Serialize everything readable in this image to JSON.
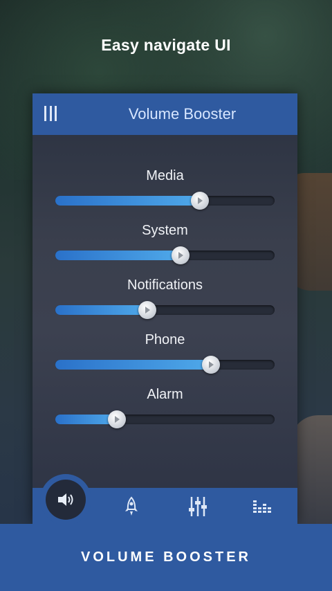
{
  "headline": "Easy navigate UI",
  "app": {
    "title": "Volume Booster",
    "menu_icon": "menu-icon"
  },
  "sliders": [
    {
      "label": "Media",
      "level": 0.66
    },
    {
      "label": "System",
      "level": 0.57
    },
    {
      "label": "Notifications",
      "level": 0.42
    },
    {
      "label": "Phone",
      "level": 0.71
    },
    {
      "label": "Alarm",
      "level": 0.28
    }
  ],
  "bottom_nav": {
    "items": [
      {
        "icon": "speaker-icon",
        "active": true
      },
      {
        "icon": "rocket-icon",
        "active": false
      },
      {
        "icon": "equalizer-icon",
        "active": false
      },
      {
        "icon": "bars-icon",
        "active": false
      }
    ]
  },
  "footer": {
    "title": "VOLUME BOOSTER"
  },
  "colors": {
    "accent": "#2f5aa0",
    "slider_fill": "#4fa9ea",
    "card_bg": "#3a3f4d"
  }
}
